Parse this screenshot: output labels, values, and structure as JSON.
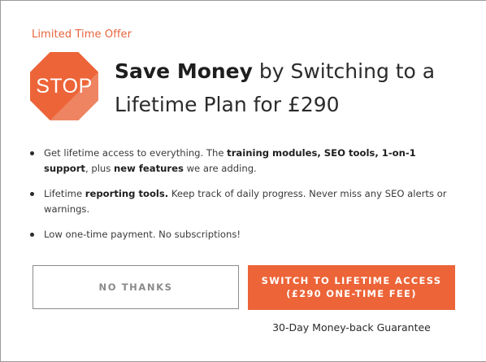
{
  "offer": {
    "eyebrow": "Limited Time Offer",
    "stop_label": "STOP",
    "headline_bold": "Save Money",
    "headline_rest": " by Switching to a Lifetime Plan for £290"
  },
  "benefits": [
    {
      "parts": [
        {
          "t": "Get lifetime access to everything. The ",
          "b": false
        },
        {
          "t": "training modules, SEO tools, 1-on-1 support",
          "b": true
        },
        {
          "t": ", plus ",
          "b": false
        },
        {
          "t": "new features",
          "b": true
        },
        {
          "t": " we are adding.",
          "b": false
        }
      ]
    },
    {
      "parts": [
        {
          "t": "Lifetime ",
          "b": false
        },
        {
          "t": "reporting tools.",
          "b": true
        },
        {
          "t": " Keep track of daily progress. Never miss any SEO alerts or warnings.",
          "b": false
        }
      ]
    },
    {
      "parts": [
        {
          "t": "Low one-time payment. No subscriptions!",
          "b": false
        }
      ]
    }
  ],
  "actions": {
    "decline_label": "NO THANKS",
    "accept_line1": "SWITCH TO LIFETIME ACCESS",
    "accept_line2": "(£290 ONE-TIME FEE)",
    "guarantee": "30-Day Money-back Guarantee"
  },
  "colors": {
    "accent": "#ec6438",
    "stop_sign": "#ec6438",
    "stop_sign_shade": "#f08a6a",
    "text": "#2a2a2a"
  }
}
